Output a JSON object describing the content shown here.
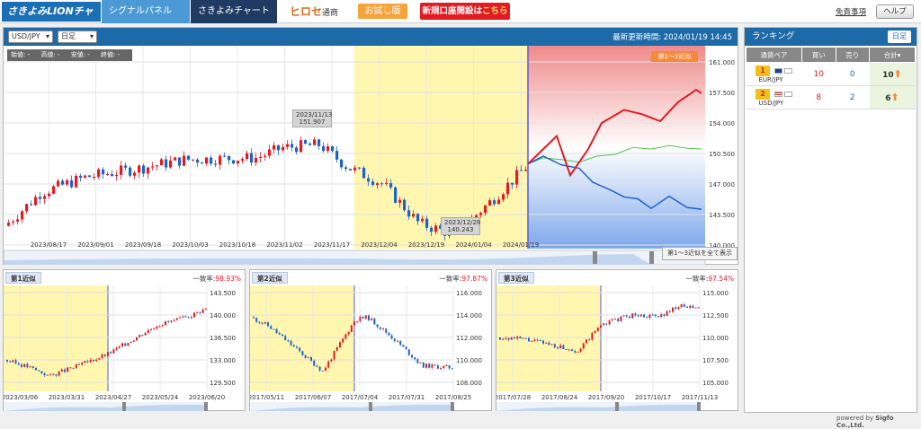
{
  "topbar": {
    "logo": "さきよみLIONチャート",
    "tabs": [
      "シグナルパネル",
      "さきよみチャート"
    ],
    "broker": "ヒロセ",
    "broker_sub": "通商",
    "try_label": "お試し版",
    "open_label": "新規口座開設は",
    "open_here": "こちら",
    "disclaimer": "免責事項",
    "help": "ヘルプ"
  },
  "main": {
    "pair": "USD/JPY",
    "period": "日足",
    "updated_label": "最新更新時間: 2024/01/19 14:45",
    "ohlc": [
      "始値: -",
      "高値: -",
      "安値: -",
      "終値: -"
    ],
    "near_label": "第1〜3近似",
    "tip_high_date": "2023/11/13",
    "tip_high_value": "151.907",
    "tip_low_date": "2023/12/28",
    "tip_low_value": "140.243",
    "show_all": "第1〜3近似を全て表示",
    "y_ticks": [
      "161.000",
      "157.500",
      "154.000",
      "150.500",
      "147.000",
      "143.500",
      "140.000"
    ],
    "x_ticks": [
      "2023/08/17",
      "2023/09/01",
      "2023/09/18",
      "2023/10/03",
      "2023/10/18",
      "2023/11/02",
      "2023/11/17",
      "2023/12/04",
      "2023/12/19",
      "2024/01/04",
      "2024/01/19"
    ]
  },
  "panels": [
    {
      "title": "第1近似",
      "match_label": "一致率:",
      "match": "98.93%",
      "y_ticks": [
        "143.500",
        "140.000",
        "136.500",
        "133.000",
        "129.500"
      ],
      "x_ticks": [
        "2023/03/06",
        "2023/03/31",
        "2023/04/27",
        "2023/05/24",
        "2023/06/20"
      ]
    },
    {
      "title": "第2近似",
      "match_label": "一致率:",
      "match": "97.87%",
      "y_ticks": [
        "116.000",
        "114.000",
        "112.000",
        "110.000",
        "108.000"
      ],
      "x_ticks": [
        "2017/05/11",
        "2017/06/07",
        "2017/07/04",
        "2017/07/31",
        "2017/08/25"
      ]
    },
    {
      "title": "第3近似",
      "match_label": "一致率:",
      "match": "97.54%",
      "y_ticks": [
        "115.000",
        "112.500",
        "110.000",
        "107.500",
        "105.000"
      ],
      "x_ticks": [
        "2017/07/28",
        "2017/08/24",
        "2017/09/20",
        "2017/10/17",
        "2017/11/13"
      ]
    }
  ],
  "ranking": {
    "title": "ランキング",
    "period_btn": "日足",
    "headers": [
      "通貨ペア",
      "買い",
      "売り",
      "合計"
    ],
    "rows": [
      {
        "rank": "1",
        "pair": "EUR/JPY",
        "buy": "10",
        "sell": "0",
        "total": "10"
      },
      {
        "rank": "2",
        "pair": "USD/JPY",
        "buy": "8",
        "sell": "2",
        "total": "6"
      }
    ]
  },
  "footer": {
    "powered": "powered by",
    "company": "Sigfo Co.,Ltd."
  },
  "colors": {
    "up": "#e31b23",
    "down": "#1d63c8",
    "accent": "#1d6aa8",
    "highlight": "#fff6b0"
  }
}
